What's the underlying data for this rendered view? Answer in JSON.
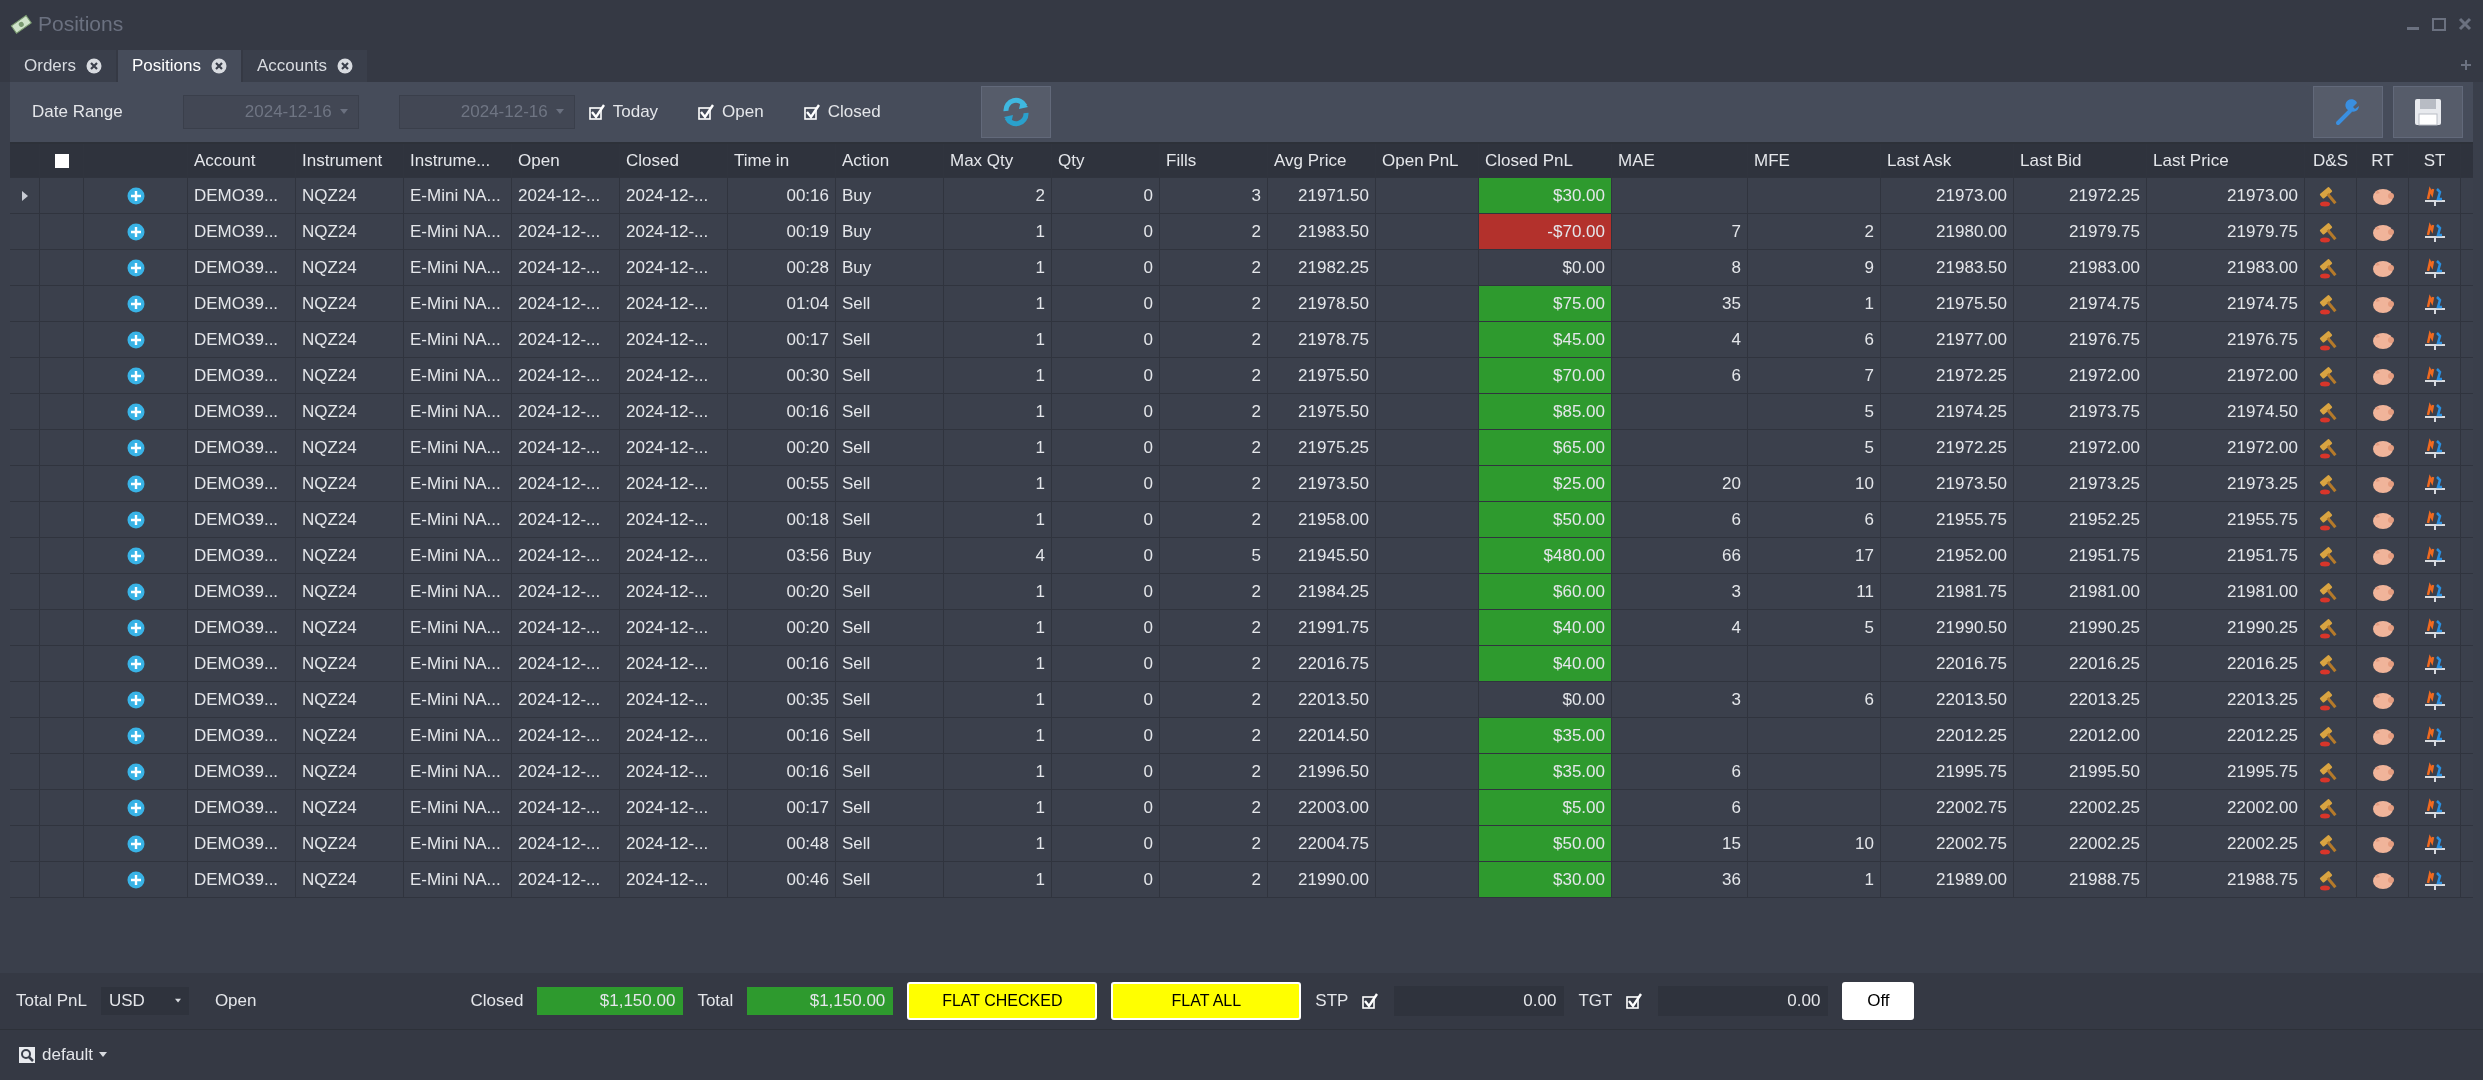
{
  "window": {
    "title": "Positions"
  },
  "tabs": [
    {
      "label": "Orders",
      "selected": false
    },
    {
      "label": "Positions",
      "selected": true
    },
    {
      "label": "Accounts",
      "selected": false
    }
  ],
  "toolbar": {
    "date_range_label": "Date Range",
    "date_from": "2024-12-16",
    "date_to": "2024-12-16",
    "filters": [
      {
        "label": "Today",
        "checked": true
      },
      {
        "label": "Open",
        "checked": true
      },
      {
        "label": "Closed",
        "checked": true
      }
    ]
  },
  "table": {
    "select_all": {
      "checked": false
    },
    "columns": [
      "Account",
      "Instrument",
      "Instrume...",
      "Open",
      "Closed",
      "Time in",
      "Action",
      "Max Qty",
      "Qty",
      "Fills",
      "Avg Price",
      "Open PnL",
      "Closed PnL",
      "MAE",
      "MFE",
      "Last Ask",
      "Last Bid",
      "Last Price",
      "D&S",
      "RT",
      "ST"
    ],
    "rows": [
      {
        "current": true,
        "account": "DEMO39...",
        "instrument": "NQZ24",
        "instrument_name": "E-Mini NA...",
        "open": "2024-12-...",
        "closed": "2024-12-...",
        "time_in": "00:16",
        "action": "Buy",
        "max_qty": "2",
        "qty": "0",
        "fills": "3",
        "avg_price": "21971.50",
        "closed_pnl": {
          "text": "$30.00",
          "color": "#2e9a2e"
        },
        "last_ask": "21973.00",
        "last_bid": "21972.25",
        "last_price": "21973.00"
      },
      {
        "current": false,
        "account": "DEMO39...",
        "instrument": "NQZ24",
        "instrument_name": "E-Mini NA...",
        "open": "2024-12-...",
        "closed": "2024-12-...",
        "time_in": "00:19",
        "action": "Buy",
        "max_qty": "1",
        "qty": "0",
        "fills": "2",
        "avg_price": "21983.50",
        "closed_pnl": {
          "text": "-$70.00",
          "color": "#b3312c"
        },
        "mae": "7",
        "mfe": "2",
        "last_ask": "21980.00",
        "last_bid": "21979.75",
        "last_price": "21979.75"
      },
      {
        "current": false,
        "account": "DEMO39...",
        "instrument": "NQZ24",
        "instrument_name": "E-Mini NA...",
        "open": "2024-12-...",
        "closed": "2024-12-...",
        "time_in": "00:28",
        "action": "Buy",
        "max_qty": "1",
        "qty": "0",
        "fills": "2",
        "avg_price": "21982.25",
        "closed_pnl": {
          "text": "$0.00"
        },
        "mae": "8",
        "mfe": "9",
        "last_ask": "21983.50",
        "last_bid": "21983.00",
        "last_price": "21983.00"
      },
      {
        "current": false,
        "account": "DEMO39...",
        "instrument": "NQZ24",
        "instrument_name": "E-Mini NA...",
        "open": "2024-12-...",
        "closed": "2024-12-...",
        "time_in": "01:04",
        "action": "Sell",
        "max_qty": "1",
        "qty": "0",
        "fills": "2",
        "avg_price": "21978.50",
        "closed_pnl": {
          "text": "$75.00",
          "color": "#2e9a2e"
        },
        "mae": "35",
        "mfe": "1",
        "last_ask": "21975.50",
        "last_bid": "21974.75",
        "last_price": "21974.75"
      },
      {
        "current": false,
        "account": "DEMO39...",
        "instrument": "NQZ24",
        "instrument_name": "E-Mini NA...",
        "open": "2024-12-...",
        "closed": "2024-12-...",
        "time_in": "00:17",
        "action": "Sell",
        "max_qty": "1",
        "qty": "0",
        "fills": "2",
        "avg_price": "21978.75",
        "closed_pnl": {
          "text": "$45.00",
          "color": "#2e9a2e"
        },
        "mae": "4",
        "mfe": "6",
        "last_ask": "21977.00",
        "last_bid": "21976.75",
        "last_price": "21976.75"
      },
      {
        "current": false,
        "account": "DEMO39...",
        "instrument": "NQZ24",
        "instrument_name": "E-Mini NA...",
        "open": "2024-12-...",
        "closed": "2024-12-...",
        "time_in": "00:30",
        "action": "Sell",
        "max_qty": "1",
        "qty": "0",
        "fills": "2",
        "avg_price": "21975.50",
        "closed_pnl": {
          "text": "$70.00",
          "color": "#2e9a2e"
        },
        "mae": "6",
        "mfe": "7",
        "last_ask": "21972.25",
        "last_bid": "21972.00",
        "last_price": "21972.00"
      },
      {
        "current": false,
        "account": "DEMO39...",
        "instrument": "NQZ24",
        "instrument_name": "E-Mini NA...",
        "open": "2024-12-...",
        "closed": "2024-12-...",
        "time_in": "00:16",
        "action": "Sell",
        "max_qty": "1",
        "qty": "0",
        "fills": "2",
        "avg_price": "21975.50",
        "closed_pnl": {
          "text": "$85.00",
          "color": "#2e9a2e"
        },
        "mfe": "5",
        "last_ask": "21974.25",
        "last_bid": "21973.75",
        "last_price": "21974.50"
      },
      {
        "current": false,
        "account": "DEMO39...",
        "instrument": "NQZ24",
        "instrument_name": "E-Mini NA...",
        "open": "2024-12-...",
        "closed": "2024-12-...",
        "time_in": "00:20",
        "action": "Sell",
        "max_qty": "1",
        "qty": "0",
        "fills": "2",
        "avg_price": "21975.25",
        "closed_pnl": {
          "text": "$65.00",
          "color": "#2e9a2e"
        },
        "mfe": "5",
        "last_ask": "21972.25",
        "last_bid": "21972.00",
        "last_price": "21972.00"
      },
      {
        "current": false,
        "account": "DEMO39...",
        "instrument": "NQZ24",
        "instrument_name": "E-Mini NA...",
        "open": "2024-12-...",
        "closed": "2024-12-...",
        "time_in": "00:55",
        "action": "Sell",
        "max_qty": "1",
        "qty": "0",
        "fills": "2",
        "avg_price": "21973.50",
        "closed_pnl": {
          "text": "$25.00",
          "color": "#2e9a2e"
        },
        "mae": "20",
        "mfe": "10",
        "last_ask": "21973.50",
        "last_bid": "21973.25",
        "last_price": "21973.25"
      },
      {
        "current": false,
        "account": "DEMO39...",
        "instrument": "NQZ24",
        "instrument_name": "E-Mini NA...",
        "open": "2024-12-...",
        "closed": "2024-12-...",
        "time_in": "00:18",
        "action": "Sell",
        "max_qty": "1",
        "qty": "0",
        "fills": "2",
        "avg_price": "21958.00",
        "closed_pnl": {
          "text": "$50.00",
          "color": "#2e9a2e"
        },
        "mae": "6",
        "mfe": "6",
        "last_ask": "21955.75",
        "last_bid": "21952.25",
        "last_price": "21955.75"
      },
      {
        "current": false,
        "account": "DEMO39...",
        "instrument": "NQZ24",
        "instrument_name": "E-Mini NA...",
        "open": "2024-12-...",
        "closed": "2024-12-...",
        "time_in": "03:56",
        "action": "Buy",
        "max_qty": "4",
        "qty": "0",
        "fills": "5",
        "avg_price": "21945.50",
        "closed_pnl": {
          "text": "$480.00",
          "color": "#2e9a2e"
        },
        "mae": "66",
        "mfe": "17",
        "last_ask": "21952.00",
        "last_bid": "21951.75",
        "last_price": "21951.75"
      },
      {
        "current": false,
        "account": "DEMO39...",
        "instrument": "NQZ24",
        "instrument_name": "E-Mini NA...",
        "open": "2024-12-...",
        "closed": "2024-12-...",
        "time_in": "00:20",
        "action": "Sell",
        "max_qty": "1",
        "qty": "0",
        "fills": "2",
        "avg_price": "21984.25",
        "closed_pnl": {
          "text": "$60.00",
          "color": "#2e9a2e"
        },
        "mae": "3",
        "mfe": "11",
        "last_ask": "21981.75",
        "last_bid": "21981.00",
        "last_price": "21981.00"
      },
      {
        "current": false,
        "account": "DEMO39...",
        "instrument": "NQZ24",
        "instrument_name": "E-Mini NA...",
        "open": "2024-12-...",
        "closed": "2024-12-...",
        "time_in": "00:20",
        "action": "Sell",
        "max_qty": "1",
        "qty": "0",
        "fills": "2",
        "avg_price": "21991.75",
        "closed_pnl": {
          "text": "$40.00",
          "color": "#2e9a2e"
        },
        "mae": "4",
        "mfe": "5",
        "last_ask": "21990.50",
        "last_bid": "21990.25",
        "last_price": "21990.25"
      },
      {
        "current": false,
        "account": "DEMO39...",
        "instrument": "NQZ24",
        "instrument_name": "E-Mini NA...",
        "open": "2024-12-...",
        "closed": "2024-12-...",
        "time_in": "00:16",
        "action": "Sell",
        "max_qty": "1",
        "qty": "0",
        "fills": "2",
        "avg_price": "22016.75",
        "closed_pnl": {
          "text": "$40.00",
          "color": "#2e9a2e"
        },
        "last_ask": "22016.75",
        "last_bid": "22016.25",
        "last_price": "22016.25"
      },
      {
        "current": false,
        "account": "DEMO39...",
        "instrument": "NQZ24",
        "instrument_name": "E-Mini NA...",
        "open": "2024-12-...",
        "closed": "2024-12-...",
        "time_in": "00:35",
        "action": "Sell",
        "max_qty": "1",
        "qty": "0",
        "fills": "2",
        "avg_price": "22013.50",
        "closed_pnl": {
          "text": "$0.00"
        },
        "mae": "3",
        "mfe": "6",
        "last_ask": "22013.50",
        "last_bid": "22013.25",
        "last_price": "22013.25"
      },
      {
        "current": false,
        "account": "DEMO39...",
        "instrument": "NQZ24",
        "instrument_name": "E-Mini NA...",
        "open": "2024-12-...",
        "closed": "2024-12-...",
        "time_in": "00:16",
        "action": "Sell",
        "max_qty": "1",
        "qty": "0",
        "fills": "2",
        "avg_price": "22014.50",
        "closed_pnl": {
          "text": "$35.00",
          "color": "#2e9a2e"
        },
        "last_ask": "22012.25",
        "last_bid": "22012.00",
        "last_price": "22012.25"
      },
      {
        "current": false,
        "account": "DEMO39...",
        "instrument": "NQZ24",
        "instrument_name": "E-Mini NA...",
        "open": "2024-12-...",
        "closed": "2024-12-...",
        "time_in": "00:16",
        "action": "Sell",
        "max_qty": "1",
        "qty": "0",
        "fills": "2",
        "avg_price": "21996.50",
        "closed_pnl": {
          "text": "$35.00",
          "color": "#2e9a2e"
        },
        "mae": "6",
        "last_ask": "21995.75",
        "last_bid": "21995.50",
        "last_price": "21995.75"
      },
      {
        "current": false,
        "account": "DEMO39...",
        "instrument": "NQZ24",
        "instrument_name": "E-Mini NA...",
        "open": "2024-12-...",
        "closed": "2024-12-...",
        "time_in": "00:17",
        "action": "Sell",
        "max_qty": "1",
        "qty": "0",
        "fills": "2",
        "avg_price": "22003.00",
        "closed_pnl": {
          "text": "$5.00",
          "color": "#2e9a2e"
        },
        "mae": "6",
        "last_ask": "22002.75",
        "last_bid": "22002.25",
        "last_price": "22002.00"
      },
      {
        "current": false,
        "account": "DEMO39...",
        "instrument": "NQZ24",
        "instrument_name": "E-Mini NA...",
        "open": "2024-12-...",
        "closed": "2024-12-...",
        "time_in": "00:48",
        "action": "Sell",
        "max_qty": "1",
        "qty": "0",
        "fills": "2",
        "avg_price": "22004.75",
        "closed_pnl": {
          "text": "$50.00",
          "color": "#2e9a2e"
        },
        "mae": "15",
        "mfe": "10",
        "last_ask": "22002.75",
        "last_bid": "22002.25",
        "last_price": "22002.25"
      },
      {
        "current": false,
        "account": "DEMO39...",
        "instrument": "NQZ24",
        "instrument_name": "E-Mini NA...",
        "open": "2024-12-...",
        "closed": "2024-12-...",
        "time_in": "00:46",
        "action": "Sell",
        "max_qty": "1",
        "qty": "0",
        "fills": "2",
        "avg_price": "21990.00",
        "closed_pnl": {
          "text": "$30.00",
          "color": "#2e9a2e"
        },
        "mae": "36",
        "mfe": "1",
        "last_ask": "21989.00",
        "last_bid": "21988.75",
        "last_price": "21988.75"
      }
    ]
  },
  "footer": {
    "total_pnl_label": "Total PnL",
    "currency": "USD",
    "open_label": "Open",
    "closed_label": "Closed",
    "closed_value": "$1,150.00",
    "total_label": "Total",
    "total_value": "$1,150.00",
    "flat_checked": "FLAT CHECKED",
    "flat_all": "FLAT ALL",
    "stp_label": "STP",
    "stp_checked": true,
    "stp_value": "0.00",
    "tgt_label": "TGT",
    "tgt_checked": true,
    "tgt_value": "0.00",
    "toggle": "Off"
  },
  "status_bar": {
    "workspace": "default"
  }
}
